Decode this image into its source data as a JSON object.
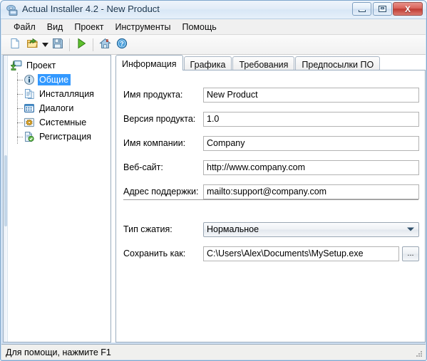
{
  "window": {
    "title": "Actual Installer 4.2 - New Product",
    "app_icon": "installer-disc-icon",
    "controls": {
      "minimize": "minimize-button",
      "maximize": "maximize-button",
      "close_label": "X"
    }
  },
  "menubar": {
    "items": [
      {
        "label": "Файл",
        "name": "menu-file"
      },
      {
        "label": "Вид",
        "name": "menu-view"
      },
      {
        "label": "Проект",
        "name": "menu-project"
      },
      {
        "label": "Инструменты",
        "name": "menu-tools"
      },
      {
        "label": "Помощь",
        "name": "menu-help"
      }
    ]
  },
  "toolbar": {
    "buttons": [
      {
        "name": "new-project-icon",
        "tip": "new"
      },
      {
        "name": "open-project-icon",
        "tip": "open"
      },
      {
        "name": "open-dropdown-arrow-icon",
        "tip": "open-recent"
      },
      {
        "name": "save-project-icon",
        "tip": "save"
      },
      {
        "name": "build-run-icon",
        "tip": "build"
      },
      {
        "name": "home-icon",
        "tip": "home"
      },
      {
        "name": "help-icon",
        "tip": "help"
      }
    ]
  },
  "tree": {
    "root": {
      "label": "Проект",
      "icon": "project-download-icon"
    },
    "items": [
      {
        "label": "Общие",
        "icon": "info-icon",
        "selected": true
      },
      {
        "label": "Инсталляция",
        "icon": "document-icon",
        "selected": false
      },
      {
        "label": "Диалоги",
        "icon": "dialogs-grid-icon",
        "selected": false
      },
      {
        "label": "Системные",
        "icon": "system-gear-icon",
        "selected": false
      },
      {
        "label": "Регистрация",
        "icon": "registration-icon",
        "selected": false
      }
    ]
  },
  "tabs": [
    {
      "label": "Информация",
      "active": true
    },
    {
      "label": "Графика",
      "active": false
    },
    {
      "label": "Требования",
      "active": false
    },
    {
      "label": "Предпосылки ПО",
      "active": false
    }
  ],
  "form": {
    "product_name": {
      "label": "Имя продукта:",
      "value": "New Product"
    },
    "product_version": {
      "label": "Версия продукта:",
      "value": "1.0"
    },
    "company_name": {
      "label": "Имя компании:",
      "value": "Company"
    },
    "website": {
      "label": "Веб-сайт:",
      "value": "http://www.company.com"
    },
    "support": {
      "label": "Адрес поддержки:",
      "value": "mailto:support@company.com"
    },
    "compression": {
      "label": "Тип сжатия:",
      "value": "Нормальное"
    },
    "save_as": {
      "label": "Сохранить как:",
      "value": "C:\\Users\\Alex\\Documents\\MySetup.exe",
      "browse_label": "..."
    }
  },
  "statusbar": {
    "text": "Для помощи, нажмите F1"
  },
  "colors": {
    "selection": "#3399ff",
    "titlebar": "#e2ecf7",
    "close_button": "#bf3c33",
    "frame_border": "#7ea6cc"
  }
}
